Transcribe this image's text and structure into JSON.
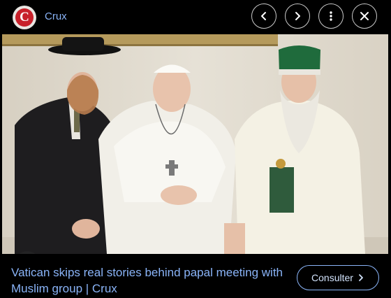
{
  "header": {
    "site_logo_letter": "C",
    "site_name": "Crux",
    "buttons": {
      "previous_icon": "chevron-left",
      "next_icon": "chevron-right",
      "more_icon": "more-vert",
      "close_icon": "close"
    }
  },
  "image": {
    "lens_icon": "google-lens"
  },
  "result": {
    "title": "Vatican skips real stories behind papal meeting with Muslim group | Crux",
    "visit_label": "Consulter",
    "visit_icon": "chevron-right"
  },
  "colors": {
    "link": "#8ab4f8",
    "logo_red": "#c8202a",
    "background": "#000000"
  }
}
